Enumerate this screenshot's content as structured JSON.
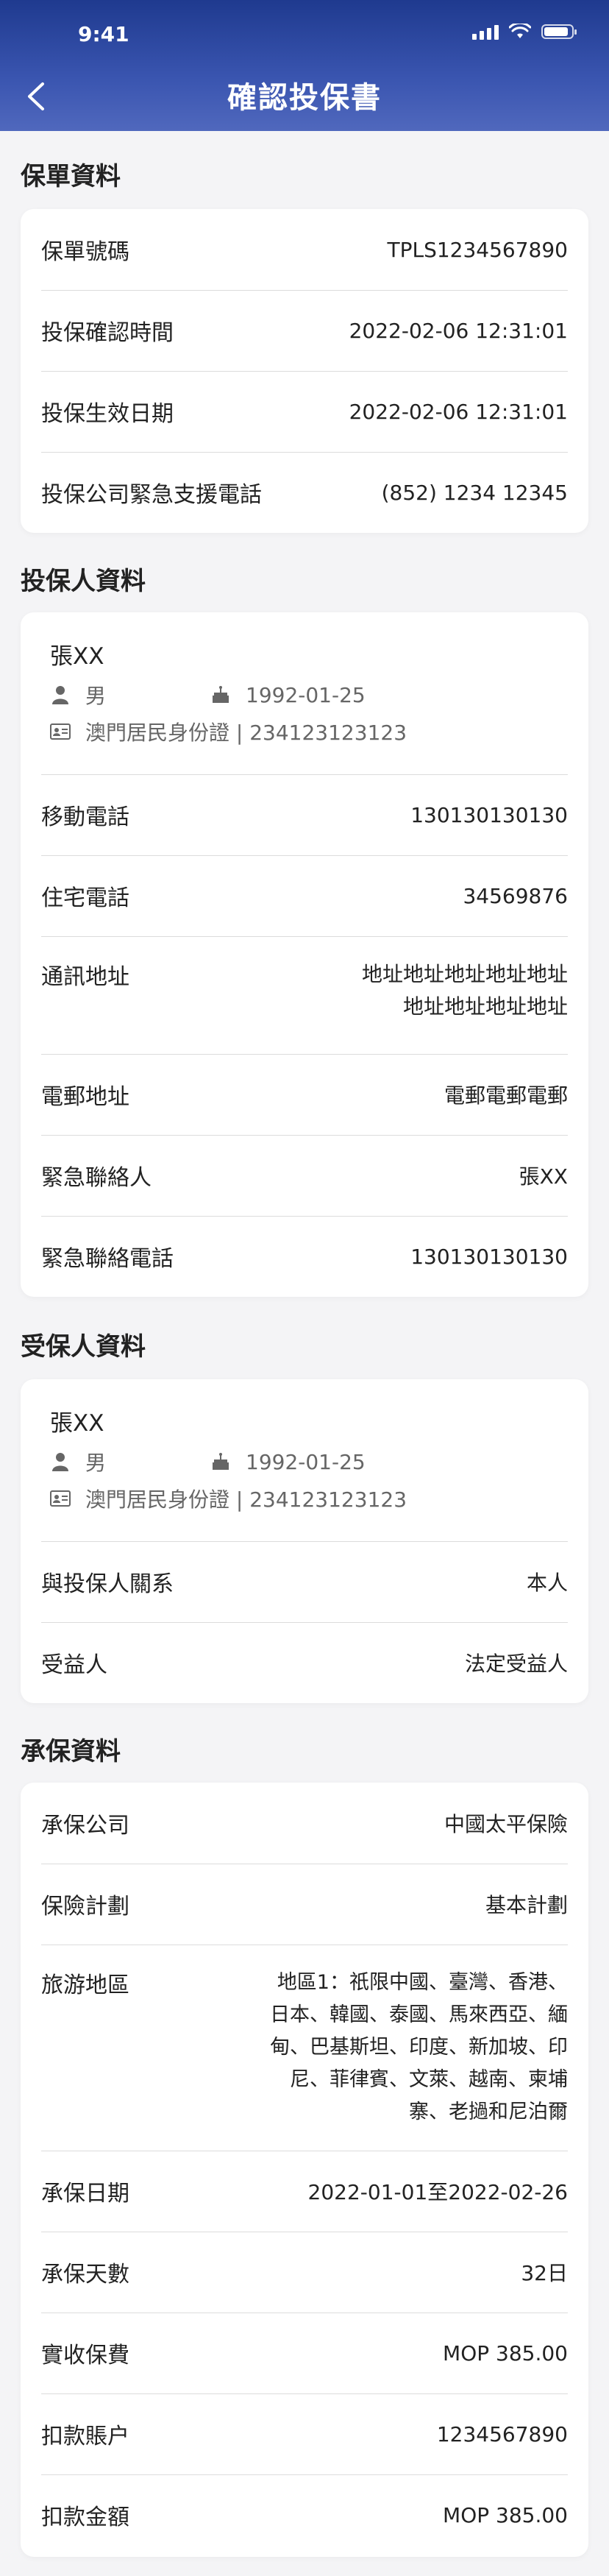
{
  "status_bar": {
    "time": "9:41"
  },
  "header": {
    "title": "確認投保書"
  },
  "policy": {
    "section_title": "保單資料",
    "rows": [
      {
        "label": "保單號碼",
        "value": "TPLS1234567890"
      },
      {
        "label": "投保確認時間",
        "value": "2022-02-06 12:31:01"
      },
      {
        "label": "投保生效日期",
        "value": "2022-02-06 12:31:01"
      },
      {
        "label": "投保公司緊急支援電話",
        "value": "(852) 1234 12345"
      }
    ]
  },
  "applicant": {
    "section_title": "投保人資料",
    "name": "張XX",
    "gender": "男",
    "birthday": "1992-01-25",
    "id_info": "澳門居民身份證 | 234123123123",
    "rows": [
      {
        "label": "移動電話",
        "value": "130130130130"
      },
      {
        "label": "住宅電話",
        "value": "34569876"
      },
      {
        "label": "通訊地址",
        "value": "地址地址地址地址地址\n地址地址地址地址"
      },
      {
        "label": "電郵地址",
        "value": "電郵電郵電郵"
      },
      {
        "label": "緊急聯絡人",
        "value": "張XX"
      },
      {
        "label": "緊急聯絡電話",
        "value": "130130130130"
      }
    ]
  },
  "insured": {
    "section_title": "受保人資料",
    "name": "張XX",
    "gender": "男",
    "birthday": "1992-01-25",
    "id_info": "澳門居民身份證 | 234123123123",
    "rows": [
      {
        "label": "與投保人關系",
        "value": "本人"
      },
      {
        "label": "受益人",
        "value": "法定受益人"
      }
    ]
  },
  "coverage": {
    "section_title": "承保資料",
    "rows": [
      {
        "label": "承保公司",
        "value": "中國太平保險"
      },
      {
        "label": "保險計劃",
        "value": "基本計劃"
      },
      {
        "label": "旅游地區",
        "value": "地區1：祇限中國、臺灣、香港、\n日本、韓國、泰國、馬來西亞、緬\n甸、巴基斯坦、印度、新加坡、印\n尼、菲律賓、文萊、越南、柬埔\n寨、老撾和尼泊爾"
      },
      {
        "label": "承保日期",
        "value": "2022-01-01至2022-02-26"
      },
      {
        "label": "承保天數",
        "value": "32日"
      },
      {
        "label": "實收保費",
        "value": "MOP 385.00"
      },
      {
        "label": "扣款賬户",
        "value": "1234567890"
      },
      {
        "label": "扣款金額",
        "value": "MOP 385.00"
      }
    ]
  },
  "colors": {
    "header_top": "#1f3a8f",
    "header_bottom": "#5068bd",
    "background": "#f4f4f6"
  }
}
